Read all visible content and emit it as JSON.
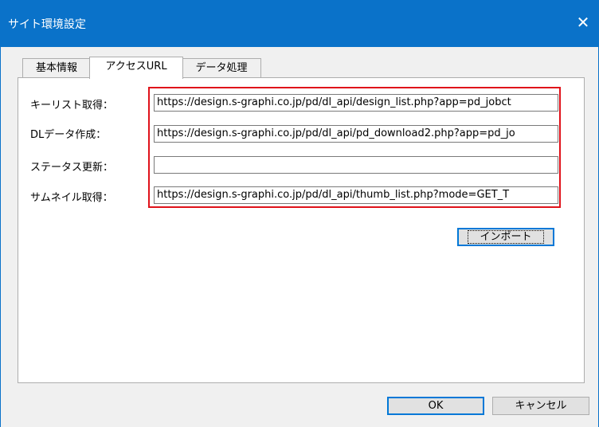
{
  "window": {
    "title": "サイト環境設定",
    "close_glyph": "✕",
    "title_bar_color": "#0a72c9"
  },
  "tabs": [
    {
      "label": "基本情報",
      "active": false
    },
    {
      "label": "アクセスURL",
      "active": true
    },
    {
      "label": "データ処理",
      "active": false
    }
  ],
  "fields": [
    {
      "label": "キーリスト取得：",
      "value": "https://design.s-graphi.co.jp/pd/dl_api/design_list.php?app=pd_jobct"
    },
    {
      "label": "DLデータ作成：",
      "value": "https://design.s-graphi.co.jp/pd/dl_api/pd_download2.php?app=pd_jo"
    },
    {
      "label": "ステータス更新：",
      "value": ""
    },
    {
      "label": "サムネイル取得：",
      "value": "https://design.s-graphi.co.jp/pd/dl_api/thumb_list.php?mode=GET_T"
    }
  ],
  "highlight_color": "#e0121a",
  "buttons": {
    "import": "インポート",
    "ok": "OK",
    "cancel": "キャンセル"
  }
}
